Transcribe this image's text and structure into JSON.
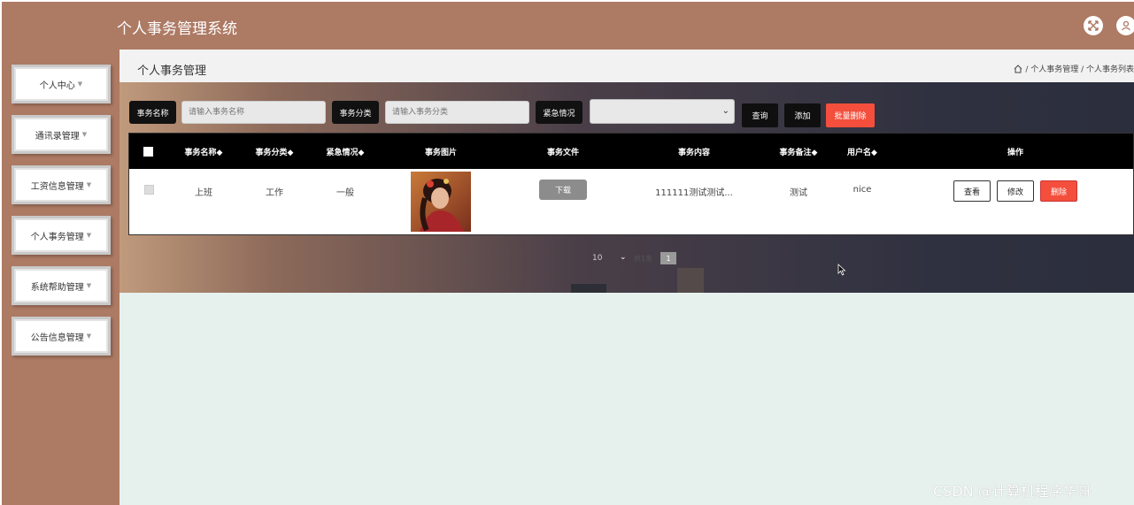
{
  "app": {
    "title": "个人事务管理系统"
  },
  "header_icons": [
    "fullscreen-icon",
    "user-icon"
  ],
  "sidebar": {
    "items": [
      {
        "label": "个人中心"
      },
      {
        "label": "通讯录管理"
      },
      {
        "label": "工资信息管理"
      },
      {
        "label": "个人事务管理"
      },
      {
        "label": "系统帮助管理"
      },
      {
        "label": "公告信息管理"
      }
    ]
  },
  "page": {
    "title": "个人事务管理",
    "breadcrumb": "/ 个人事务管理 / 个人事务列表"
  },
  "search": {
    "name_label": "事务名称",
    "name_placeholder": "请输入事务名称",
    "category_label": "事务分类",
    "category_placeholder": "请输入事务分类",
    "urgency_label": "紧急情况",
    "urgency_value": "",
    "query_button": "查询",
    "add_button": "添加",
    "batch_delete_button": "批量删除"
  },
  "table": {
    "columns": [
      "事务名称◆",
      "事务分类◆",
      "紧急情况◆",
      "事务图片",
      "事务文件",
      "事务内容",
      "事务备注◆",
      "用户名◆",
      "操作"
    ],
    "rows": [
      {
        "name": "上班",
        "category": "工作",
        "urgency": "一般",
        "image": "portrait-photo",
        "file_button": "下载",
        "content": "111111测试测试...",
        "remark": "测试",
        "username": "nice",
        "actions": [
          "查看",
          "修改",
          "删除"
        ]
      }
    ]
  },
  "pagination": {
    "page_size": "10",
    "total_text": "共1条",
    "current_page": "1"
  },
  "watermark": "CSDN @计算机程序华哥",
  "colors": {
    "header": "#ad7a64",
    "sidebar": "#ad7a64",
    "main_bg": "#e6f1ee",
    "danger": "#f34f3c",
    "dark": "#0f0f0f"
  }
}
